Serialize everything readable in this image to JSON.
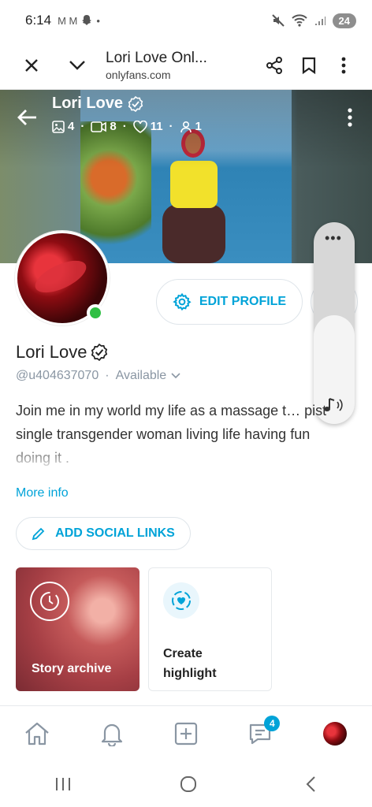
{
  "status_bar": {
    "time": "6:14",
    "left_icons": "M M",
    "battery": "24"
  },
  "browser": {
    "title": "Lori Love Onl...",
    "url": "onlyfans.com"
  },
  "cover": {
    "name": "Lori Love",
    "stats": {
      "photos": "4",
      "videos": "8",
      "likes": "11",
      "fans": "1"
    }
  },
  "profile": {
    "name": "Lori Love",
    "handle": "@u404637070",
    "separator": "·",
    "availability": "Available",
    "bio": "Join me in my world my life as a massage t… pist single transgender woman living life having fun doing it .",
    "more_info": "More info",
    "edit_profile": "EDIT PROFILE",
    "add_social_links": "ADD SOCIAL LINKS"
  },
  "cards": {
    "archive_label": "Story archive",
    "highlight_label": "Create highlight"
  },
  "nav": {
    "messages_badge": "4"
  },
  "volume": {
    "dots": "•••",
    "level": 0.54
  },
  "colors": {
    "accent": "#00a3d8",
    "online": "#2fbf43"
  }
}
